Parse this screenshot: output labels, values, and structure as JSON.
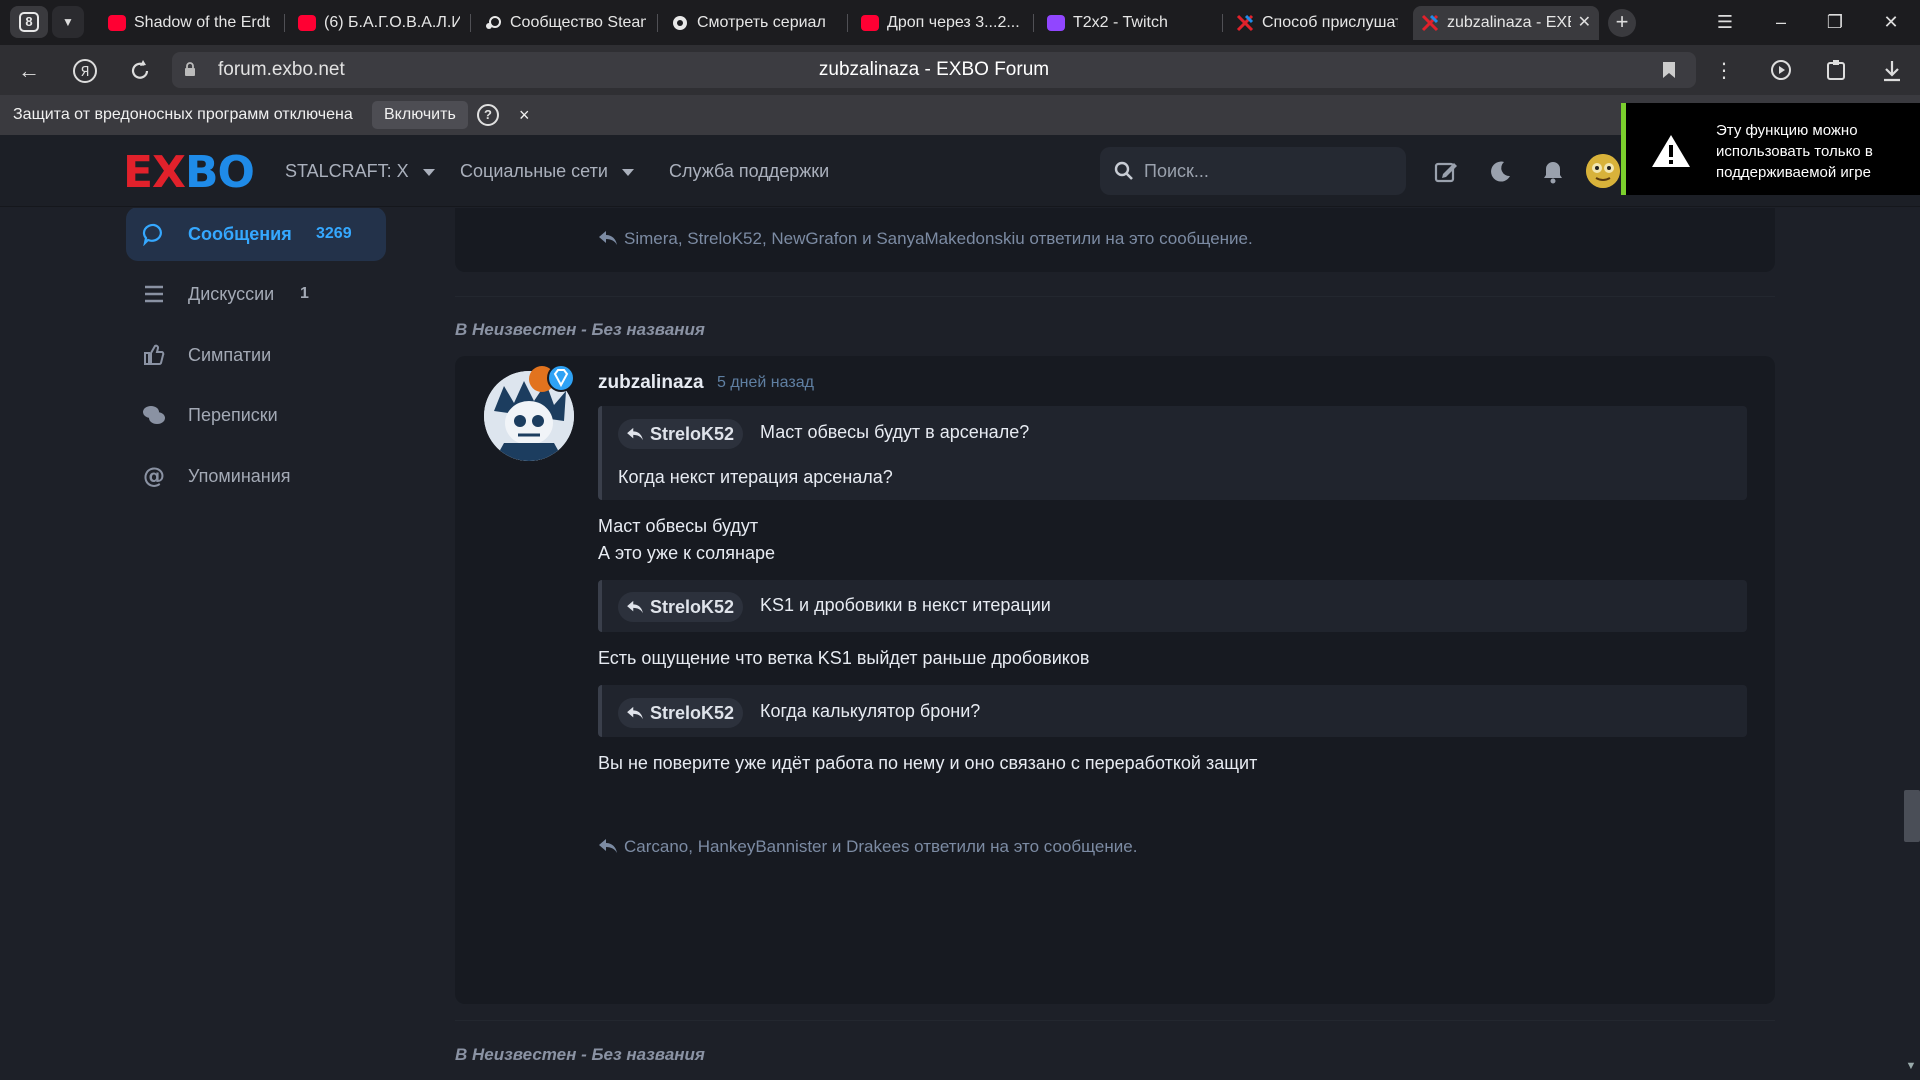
{
  "browser": {
    "tab_count": "8",
    "tabs": [
      {
        "title": "Shadow of the Erdtree",
        "favicon": "youtube-icon",
        "color": "#ff0033"
      },
      {
        "title": "(6) Б.А.Г.О.В.А.Л.И",
        "favicon": "youtube-icon",
        "color": "#ff0033"
      },
      {
        "title": "Сообщество Steam",
        "favicon": "steam-icon",
        "color": "#ffffff"
      },
      {
        "title": "Смотреть сериал",
        "favicon": "site-icon",
        "color": "#ffffff"
      },
      {
        "title": "Дроп через 3...2...",
        "favicon": "youtube-icon",
        "color": "#ff0033"
      },
      {
        "title": "T2x2 - Twitch",
        "favicon": "twitch-icon",
        "color": "#9146ff"
      },
      {
        "title": "Способ прислушаться",
        "favicon": "exbo-icon",
        "color": "#e1212b"
      },
      {
        "title": "zubzalinaza - EXBO Forum",
        "favicon": "exbo-icon",
        "color": "#e1212b",
        "active": true
      }
    ],
    "url_host": "forum.exbo.net",
    "page_title": "zubzalinaza - EXBO Forum"
  },
  "protection_banner": {
    "message": "Защита от вредоносных программ отключена",
    "enable_label": "Включить",
    "help_label": "?",
    "close_label": "×"
  },
  "header": {
    "logo_left": "EX",
    "logo_right": "BO",
    "nav": [
      {
        "label": "STALCRAFT: X",
        "dropdown": true
      },
      {
        "label": "Социальные сети",
        "dropdown": true
      },
      {
        "label": "Служба поддержки",
        "dropdown": false
      }
    ],
    "search_placeholder": "Поиск..."
  },
  "toast": {
    "message": "Эту функцию можно использовать только в поддерживаемой игре",
    "accent": "#7bcf2d"
  },
  "sidebar": {
    "items": [
      {
        "label": "Сообщения",
        "count": "3269",
        "icon": "speech-bubble-icon",
        "active": true
      },
      {
        "label": "Дискуссии",
        "count": "1",
        "icon": "list-icon",
        "active": false
      },
      {
        "label": "Симпатии",
        "count": "",
        "icon": "thumbs-up-icon",
        "active": false
      },
      {
        "label": "Переписки",
        "count": "",
        "icon": "chat-bubbles-icon",
        "active": false
      },
      {
        "label": "Упоминания",
        "count": "",
        "icon": "at-icon",
        "active": false
      }
    ]
  },
  "feed": {
    "top_replies": "Simera, StreloK52, NewGrafon и SanyaMakedonskiu ответили на это сообщение.",
    "thread_label_prefix": "В",
    "thread_label": "Неизвестен - Без названия",
    "post": {
      "author": "zubzalinaza",
      "time": "5 дней назад",
      "quote1_author": "StreloK52",
      "quote1_line1": "Маст обвесы будут в арсенале?",
      "quote1_line2": "Когда некст итерация арсенала?",
      "text1": "Маст обвесы будут",
      "text2": "А это уже к солянаре",
      "quote2_author": "StreloK52",
      "quote2_line1": "KS1 и дробовики в некст итерации",
      "text3": "Есть ощущение что ветка KS1 выйдет раньше дробовиков",
      "quote3_author": "StreloK52",
      "quote3_line1": "Когда калькулятор брони?",
      "text4": "Вы не поверите уже идёт работа по нему и оно связано с переработкой защит",
      "replies": "Carcano, HankeyBannister и Drakees ответили на это сообщение."
    },
    "next_thread_label_prefix": "В",
    "next_thread_label": "Неизвестен - Без названия"
  },
  "colors": {
    "accent_blue": "#35a8ff",
    "brand_red": "#e1212b",
    "brand_blue": "#1f8be8",
    "card_bg": "#171a21",
    "page_bg": "#1d2028"
  }
}
